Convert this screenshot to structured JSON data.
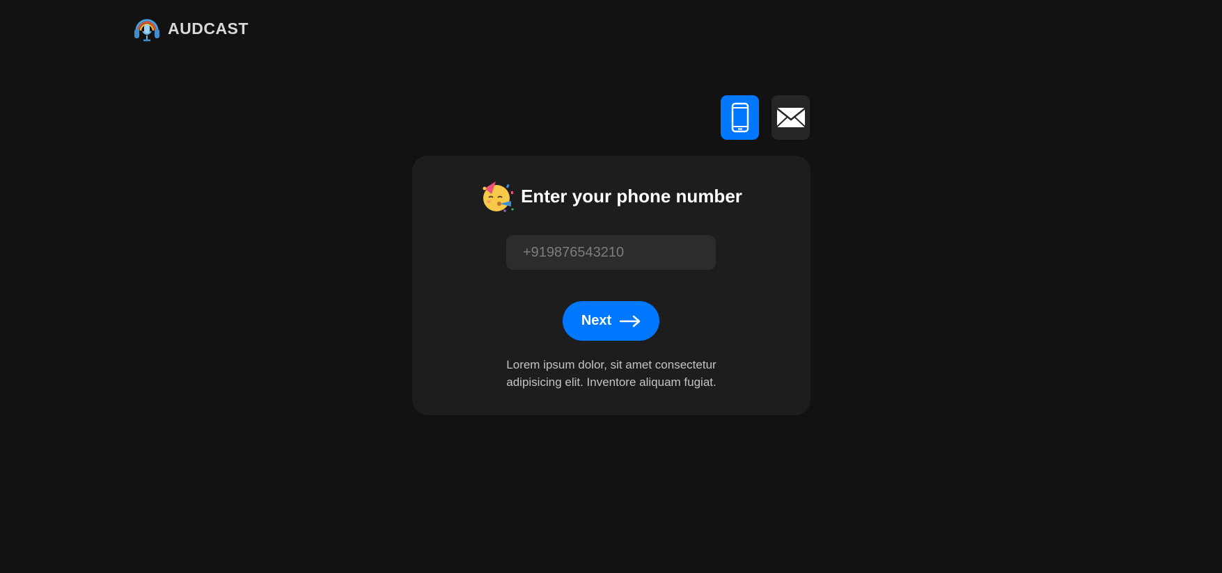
{
  "brand": {
    "name": "AUDCAST",
    "icon": "headphones-mic-icon"
  },
  "auth_modes": {
    "phone": {
      "icon": "phone-icon",
      "active": true
    },
    "email": {
      "icon": "mail-icon",
      "active": false
    }
  },
  "card": {
    "icon": "party-face-icon",
    "title": "Enter your phone number",
    "phone_input": {
      "value": "",
      "placeholder": "+919876543210"
    },
    "next_button": {
      "label": "Next",
      "icon": "arrow-right-icon"
    },
    "note_lines": [
      "Lorem ipsum dolor, sit amet consectetur",
      "adipisicing elit. Inventore aliquam fugiat."
    ]
  },
  "colors": {
    "background": "#121212",
    "card": "#1d1d1d",
    "accent": "#0077ff",
    "input_bg": "#2c2c2c",
    "inactive_toggle": "#262626"
  }
}
